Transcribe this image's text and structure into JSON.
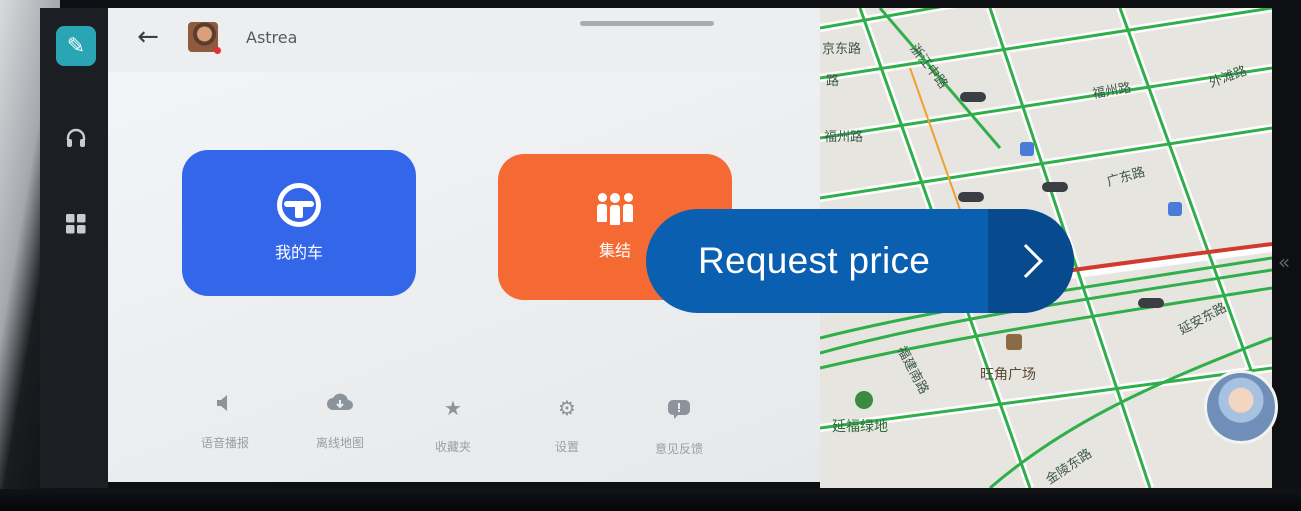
{
  "header": {
    "back_icon": "arrow-left-icon",
    "username": "Astrea"
  },
  "rail": {
    "items": [
      {
        "icon": "navigation-pen-icon",
        "active": true
      },
      {
        "icon": "headphones-icon",
        "active": false
      },
      {
        "icon": "apps-grid-icon",
        "active": false
      }
    ]
  },
  "tiles": {
    "my_car": {
      "label": "我的车",
      "icon": "steering-wheel-icon",
      "color": "#3366e8"
    },
    "gather": {
      "label": "集结",
      "icon": "group-people-icon",
      "color": "#f56a33"
    }
  },
  "tools": [
    {
      "label": "语音播报",
      "icon": "speaker-icon"
    },
    {
      "label": "离线地图",
      "icon": "cloud-download-icon"
    },
    {
      "label": "收藏夹",
      "icon": "star-icon"
    },
    {
      "label": "设置",
      "icon": "gear-icon"
    },
    {
      "label": "意见反馈",
      "icon": "feedback-icon"
    }
  ],
  "map": {
    "labels": {
      "l1": "京东路",
      "l2": "路",
      "l3": "福州路",
      "l4": "广东路",
      "l5": "福州路",
      "l6": "浙江中路",
      "l7": "福建南路",
      "l8": "旺角广场",
      "l9": "延福绿地",
      "l10": "金陵东路",
      "l11": "延安东路",
      "l12": "外滩路"
    }
  },
  "cta": {
    "label": "Request price",
    "arrow_icon": "chevron-right-icon"
  },
  "colors": {
    "accent_blue": "#0b5fb0",
    "car_tile": "#3366e8",
    "gather_tile": "#f56a33",
    "road_green": "#2fae4a"
  }
}
